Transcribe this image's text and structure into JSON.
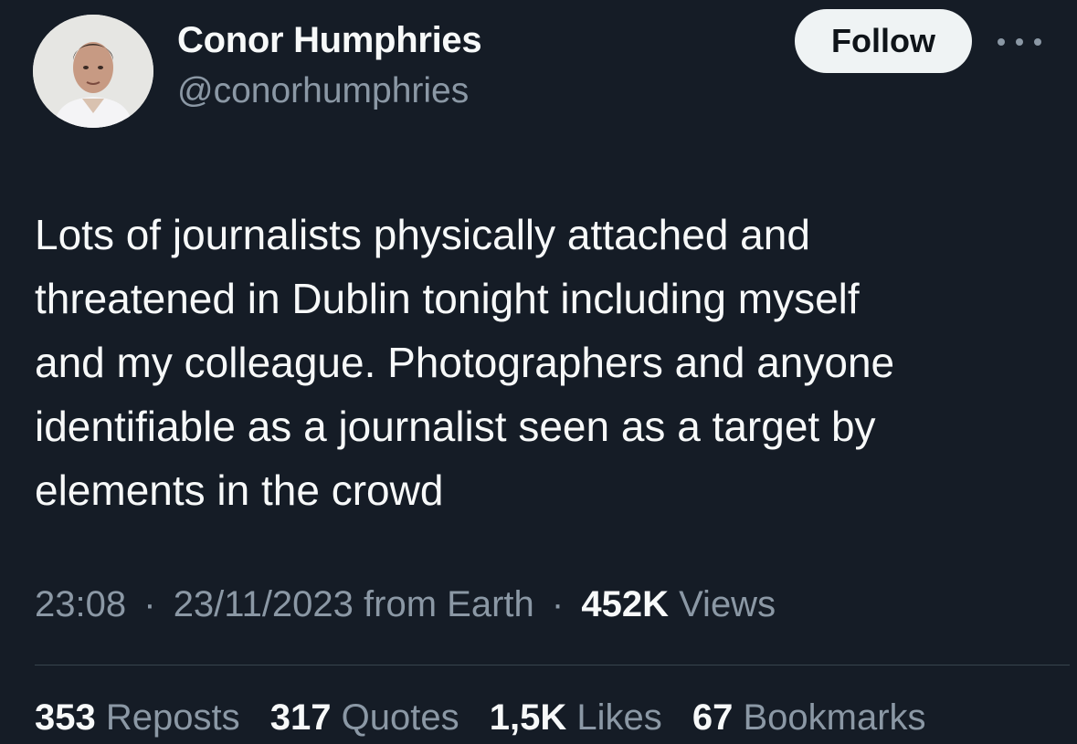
{
  "author": {
    "name": "Conor Humphries",
    "handle": "@conorhumphries"
  },
  "actions": {
    "follow_label": "Follow",
    "more_icon": "more-horizontal-icon"
  },
  "tweet": {
    "lines": [
      "Lots of journalists physically attached and",
      "threatened in Dublin tonight including myself",
      "and my colleague. Photographers and anyone",
      "identifiable as a journalist seen as a target by",
      "elements in the crowd"
    ]
  },
  "meta": {
    "time": "23:08",
    "separator": "·",
    "date": "23/11/2023",
    "source": "from Earth",
    "views_count": "452K",
    "views_label": "Views"
  },
  "stats": {
    "reposts": {
      "count": "353",
      "label": "Reposts"
    },
    "quotes": {
      "count": "317",
      "label": "Quotes"
    },
    "likes": {
      "count": "1,5K",
      "label": "Likes"
    },
    "bookmarks": {
      "count": "67",
      "label": "Bookmarks"
    }
  },
  "colors": {
    "background": "#151c26",
    "primary_text": "#f7f9f9",
    "secondary_text": "#8b98a5",
    "button_bg": "#eff3f4",
    "divider": "#38444d"
  }
}
